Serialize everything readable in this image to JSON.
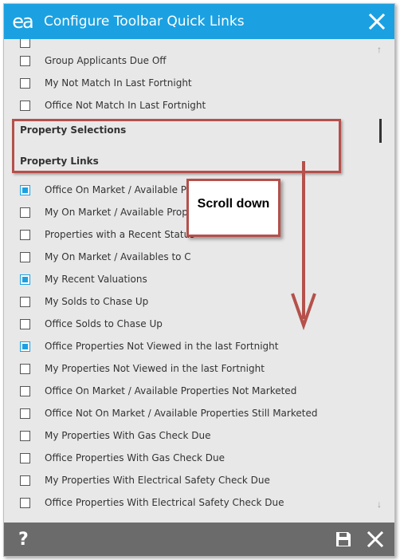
{
  "window": {
    "title": "Configure Toolbar Quick Links",
    "logo_text": "ea",
    "accent_color": "#1ba1e2"
  },
  "items_top": [
    {
      "label": "Group Applicants Due Off",
      "checked": false
    },
    {
      "label": "My Not Match In Last Fortnight",
      "checked": false
    },
    {
      "label": "Office Not Match In Last Fortnight",
      "checked": false
    }
  ],
  "sections": {
    "property_selections": "Property Selections",
    "property_links": "Property Links"
  },
  "property_links": [
    {
      "label": "Office On Market / Available Properties",
      "checked": true
    },
    {
      "label": "My On Market / Available Properties",
      "checked": false
    },
    {
      "label": "Properties with a Recent Status",
      "checked": false
    },
    {
      "label": "My On Market / Availables to C",
      "checked": false
    },
    {
      "label": "My Recent Valuations",
      "checked": true
    },
    {
      "label": "My Solds to Chase Up",
      "checked": false
    },
    {
      "label": "Office Solds to Chase Up",
      "checked": false
    },
    {
      "label": "Office Properties Not Viewed in the last Fortnight",
      "checked": true
    },
    {
      "label": "My Properties Not Viewed in the last Fortnight",
      "checked": false
    },
    {
      "label": "Office On Market / Available Properties Not Marketed",
      "checked": false
    },
    {
      "label": "Office Not On Market / Available Properties Still Marketed",
      "checked": false
    },
    {
      "label": "My Properties With Gas Check Due",
      "checked": false
    },
    {
      "label": "Office Properties With Gas Check Due",
      "checked": false
    },
    {
      "label": "My Properties With Electrical Safety Check Due",
      "checked": false
    },
    {
      "label": "Office Properties With Electrical Safety Check Due",
      "checked": false
    }
  ],
  "annotation": {
    "callout_text": "Scroll down",
    "color": "#b5504b"
  },
  "footer": {
    "help_label": "?"
  },
  "icons": {
    "close_top": "close-icon",
    "save": "save-icon",
    "close_footer": "close-icon",
    "scroll_up": "scroll-up-arrow-icon",
    "scroll_down": "scroll-down-arrow-icon"
  }
}
